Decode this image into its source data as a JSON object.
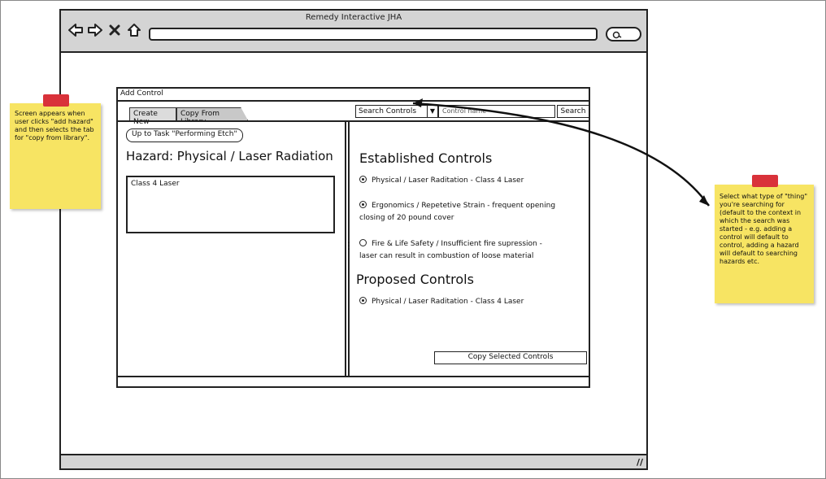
{
  "window": {
    "title": "Remedy Interactive JHA"
  },
  "dialog": {
    "title": "Add Control",
    "tabs": [
      {
        "label": "Create New"
      },
      {
        "label": "Copy From Library"
      }
    ],
    "search": {
      "select_value": "Search Controls",
      "query_value": "Control name",
      "button_label": "Search"
    },
    "left": {
      "back_link": "Up to Task \"Performing Etch\"",
      "hazard_heading": "Hazard: Physical / Laser Radiation",
      "description": "Class 4 Laser"
    },
    "right": {
      "established_heading": "Established Controls",
      "established": [
        {
          "line1": "Physical / Laser Raditation - Class 4 Laser",
          "line2": "",
          "selected": true
        },
        {
          "line1": "Ergonomics / Repetetive Strain - frequent opening",
          "line2": "closing of 20 pound cover",
          "selected": true
        },
        {
          "line1": "Fire & Life Safety / Insufficient fire supression -",
          "line2": "laser can result in combustion of loose material",
          "selected": false
        }
      ],
      "proposed_heading": "Proposed Controls",
      "proposed": [
        {
          "line1": "Physical / Laser Raditation - Class 4 Laser",
          "selected": true
        }
      ],
      "copy_button": "Copy Selected Controls"
    }
  },
  "notes": {
    "left": "Screen appears when user clicks \"add hazard\" and then selects the tab for \"copy from library\".",
    "right": "Select what type of \"thing\" you're searching for (default to the context in which the search was started - e.g. adding a control will default to control, adding a hazard will default to searching hazards etc."
  },
  "colors": {
    "sticky": "#f7e463",
    "tape": "#d9323a",
    "chrome": "#d4d4d4"
  },
  "icons": [
    "back-arrow-icon",
    "forward-arrow-icon",
    "close-icon",
    "home-icon",
    "search-icon",
    "resize-grip-icon"
  ]
}
